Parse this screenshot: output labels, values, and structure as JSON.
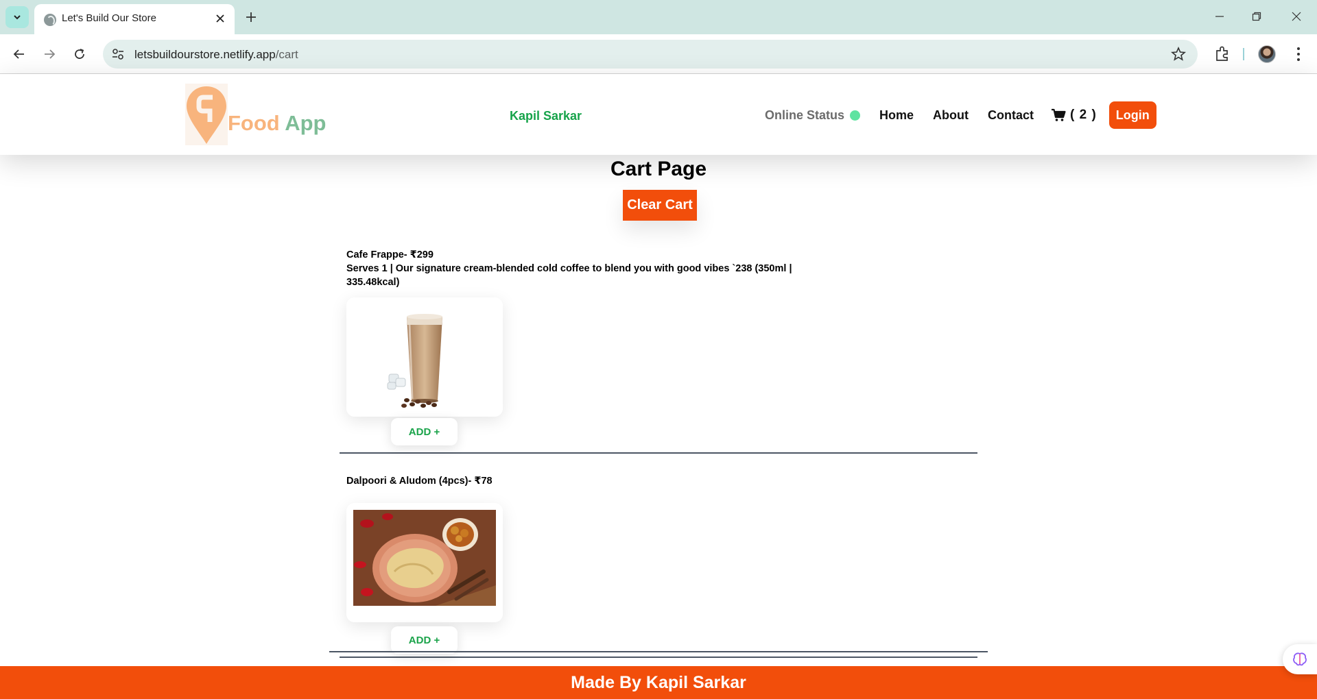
{
  "browser": {
    "tab_title": "Let's Build Our Store",
    "url_host": "letsbuildourstore.netlify.app",
    "url_path": "/cart",
    "accent_color": "#cfe6e2"
  },
  "header": {
    "logo_food": "Food",
    "logo_app": "App",
    "user_name": "Kapil Sarkar",
    "online_status_label": "Online Status",
    "online_status_color": "#5fe3a1",
    "nav": {
      "home": "Home",
      "about": "About",
      "contact": "Contact"
    },
    "cart_count": "( 2 )",
    "login_label": "Login",
    "brand_color": "#f24e0b"
  },
  "cart": {
    "title": "Cart Page",
    "clear_label": "Clear Cart",
    "items": [
      {
        "name": "Cafe Frappe- ₹299",
        "description": "Serves 1 | Our signature cream-blended cold coffee to blend you with good vibes `238 (350ml | 335.48kcal)",
        "add_label": "ADD +"
      },
      {
        "name": "Dalpoori & Aludom (4pcs)- ₹78",
        "description": "",
        "add_label": "ADD +"
      }
    ]
  },
  "footer": {
    "text": "Made By Kapil Sarkar"
  }
}
